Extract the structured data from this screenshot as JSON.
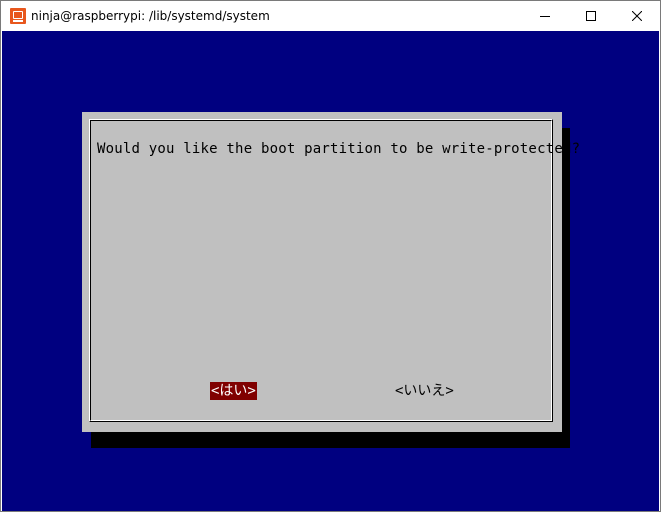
{
  "window": {
    "title": "ninja@raspberrypi: /lib/systemd/system",
    "icon": "terminal-app-icon",
    "controls": [
      "minimize-icon",
      "maximize-icon",
      "close-icon"
    ]
  },
  "dialog": {
    "question": "Would you like the boot partition to be write-protected?",
    "buttons": {
      "yes": "<はい>",
      "no": "<いいえ>"
    },
    "selected": "yes"
  },
  "colors": {
    "terminal_bg": "#000080",
    "dialog_bg": "#c0c0c0",
    "selected_bg": "#800000",
    "app_icon": "#e8571d"
  }
}
